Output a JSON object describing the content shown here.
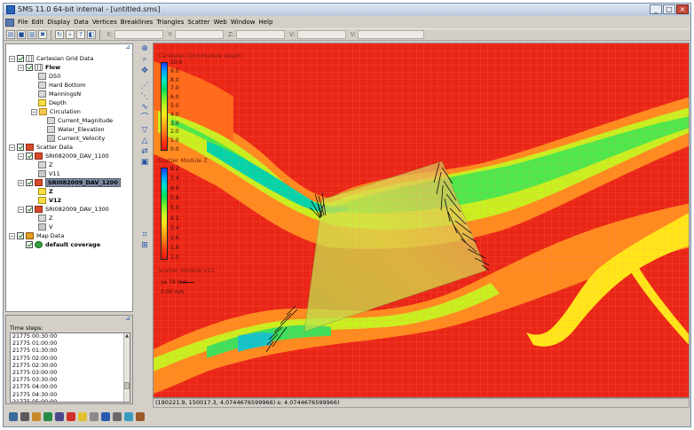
{
  "window": {
    "title": "SMS 11.0 64-bit internal - [untitled.sms]"
  },
  "menu": [
    "File",
    "Edit",
    "Display",
    "Data",
    "Vertices",
    "Breaklines",
    "Triangles",
    "Scatter",
    "Web",
    "Window",
    "Help"
  ],
  "toolbar": {
    "coord_labels": [
      "X:",
      "Y:",
      "Z:",
      "V:",
      "V:"
    ]
  },
  "tree": {
    "cartesian": "Cartesian Grid Data",
    "flow": "Flow",
    "datasets": [
      "D50",
      "Hard Bottom",
      "ManningsN",
      "Depth"
    ],
    "circulation": "Circulation",
    "circulation_items": [
      "Current_Magnitude",
      "Water_Elevation",
      "Current_Velocity"
    ],
    "scatter": "Scatter Data",
    "sets": [
      {
        "name": "SRI082009_DAV_1100",
        "children": [
          "Z",
          "V11"
        ]
      },
      {
        "name": "SRI082009_DAV_1200",
        "children": [
          "Z",
          "V12"
        ]
      },
      {
        "name": "SRI082009_DAV_1300",
        "children": [
          "Z",
          "V"
        ]
      }
    ],
    "map": "Map Data",
    "coverage": "default coverage"
  },
  "time_steps": {
    "label": "Time steps:",
    "items": [
      "21775 00:30:00",
      "21775 01:00:00",
      "21775 01:30:00",
      "21775 02:00:00",
      "21775 02:30:00",
      "21775 03:00:00",
      "21775 03:30:00",
      "21775 04:00:00",
      "21775 04:30:00",
      "21775 05:00:00",
      "21775 05:30:00"
    ],
    "selected_index": 10
  },
  "legend_depth": {
    "title": "Cartesian Grid Module Depth",
    "ticks": [
      "10.0",
      "9.0",
      "8.0",
      "7.0",
      "6.0",
      "5.0",
      "4.0",
      "3.0",
      "2.0",
      "1.0",
      "0.0"
    ]
  },
  "legend_scatter": {
    "title": "Scatter Module Z",
    "ticks": [
      "8.2",
      "7.4",
      "6.6",
      "5.8",
      "5.0",
      "4.2",
      "3.4",
      "2.6",
      "1.8",
      "1.0"
    ]
  },
  "legend_vector": {
    "title": "Scatter Module V12",
    "max_label": "ya 74 m/s",
    "min_label": "0.00 m/s"
  },
  "status": "(190221.9, 150017.3, 4.0744676599966) s: 4.0744676599966)",
  "colors": {
    "ramp": [
      "#1a3cff",
      "#00a8ff",
      "#00e5c8",
      "#00e060",
      "#6ef02a",
      "#c8f51e",
      "#ffe619",
      "#ffb014",
      "#ff7a14",
      "#ff3a12",
      "#e8140f"
    ]
  }
}
